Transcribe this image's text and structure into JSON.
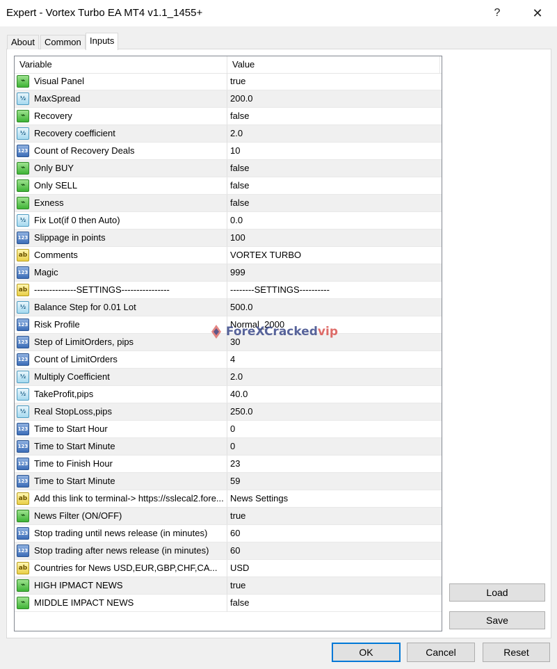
{
  "window": {
    "title": "Expert - Vortex Turbo EA MT4 v1.1_1455+",
    "help": "?",
    "close": "✕"
  },
  "tabs": [
    {
      "label": "About"
    },
    {
      "label": "Common"
    },
    {
      "label": "Inputs",
      "active": true
    }
  ],
  "grid": {
    "header": {
      "variable": "Variable",
      "value": "Value"
    },
    "rows": [
      {
        "type": "bool",
        "icon": "bool-type-icon",
        "name": "Visual Panel",
        "value": "true"
      },
      {
        "type": "double",
        "icon": "double-type-icon",
        "name": "MaxSpread",
        "value": "200.0"
      },
      {
        "type": "bool",
        "icon": "bool-type-icon",
        "name": "Recovery",
        "value": "false"
      },
      {
        "type": "double",
        "icon": "double-type-icon",
        "name": "Recovery coefficient",
        "value": "2.0"
      },
      {
        "type": "int",
        "icon": "int-type-icon",
        "name": "Count of Recovery Deals",
        "value": "10"
      },
      {
        "type": "bool",
        "icon": "bool-type-icon",
        "name": "Only BUY",
        "value": "false"
      },
      {
        "type": "bool",
        "icon": "bool-type-icon",
        "name": "Only SELL",
        "value": "false"
      },
      {
        "type": "bool",
        "icon": "bool-type-icon",
        "name": "Exness",
        "value": "false"
      },
      {
        "type": "double",
        "icon": "double-type-icon",
        "name": "Fix Lot(if 0 then Auto)",
        "value": "0.0"
      },
      {
        "type": "int",
        "icon": "int-type-icon",
        "name": "Slippage in points",
        "value": "100"
      },
      {
        "type": "string",
        "icon": "string-type-icon",
        "name": "Comments",
        "value": "VORTEX TURBO"
      },
      {
        "type": "int",
        "icon": "int-type-icon",
        "name": "Magic",
        "value": "999"
      },
      {
        "type": "string",
        "icon": "string-type-icon",
        "name": "--------------SETTINGS----------------",
        "value": "--------SETTINGS----------"
      },
      {
        "type": "double",
        "icon": "double-type-icon",
        "name": "Balance Step for 0.01 Lot",
        "value": "500.0"
      },
      {
        "type": "int",
        "icon": "int-type-icon",
        "name": "Risk Profile",
        "value": "Normal_2000"
      },
      {
        "type": "int",
        "icon": "int-type-icon",
        "name": "Step of LimitOrders, pips",
        "value": "30"
      },
      {
        "type": "int",
        "icon": "int-type-icon",
        "name": "Count of LimitOrders",
        "value": "4"
      },
      {
        "type": "double",
        "icon": "double-type-icon",
        "name": "Multiply Coefficient",
        "value": "2.0"
      },
      {
        "type": "double",
        "icon": "double-type-icon",
        "name": "TakeProfit,pips",
        "value": "40.0"
      },
      {
        "type": "double",
        "icon": "double-type-icon",
        "name": "Real StopLoss,pips",
        "value": "250.0"
      },
      {
        "type": "int",
        "icon": "int-type-icon",
        "name": "Time to Start Hour",
        "value": "0"
      },
      {
        "type": "int",
        "icon": "int-type-icon",
        "name": "Time to Start Minute",
        "value": "0"
      },
      {
        "type": "int",
        "icon": "int-type-icon",
        "name": "Time to Finish Hour",
        "value": "23"
      },
      {
        "type": "int",
        "icon": "int-type-icon",
        "name": "Time to Start Minute",
        "value": "59"
      },
      {
        "type": "string",
        "icon": "string-type-icon",
        "name": "Add this link to terminal-> https://sslecal2.fore...",
        "value": "News Settings"
      },
      {
        "type": "bool",
        "icon": "bool-type-icon",
        "name": "News Filter (ON/OFF)",
        "value": "true"
      },
      {
        "type": "int",
        "icon": "int-type-icon",
        "name": "Stop trading until news release (in minutes)",
        "value": "60"
      },
      {
        "type": "int",
        "icon": "int-type-icon",
        "name": "Stop trading after news release (in minutes)",
        "value": "60"
      },
      {
        "type": "string",
        "icon": "string-type-icon",
        "name": "Countries for News USD,EUR,GBP,CHF,CA...",
        "value": "USD"
      },
      {
        "type": "bool",
        "icon": "bool-type-icon",
        "name": "HIGH IPMACT NEWS",
        "value": "true"
      },
      {
        "type": "bool",
        "icon": "bool-type-icon",
        "name": "MIDDLE IMPACT NEWS",
        "value": "false"
      }
    ]
  },
  "side_buttons": {
    "load": "Load",
    "save": "Save"
  },
  "footer_buttons": {
    "ok": "OK",
    "cancel": "Cancel",
    "reset": "Reset"
  },
  "watermark": {
    "part1": "ForeX",
    "part2": "Cracked",
    "part3": "vip"
  },
  "icon_glyphs": {
    "bool": "⌁",
    "double": "½",
    "int": "123",
    "string": "ab"
  },
  "colors": {
    "accent": "#0078d7",
    "grid_border": "#828790",
    "alt_row": "#f0f0f0"
  }
}
